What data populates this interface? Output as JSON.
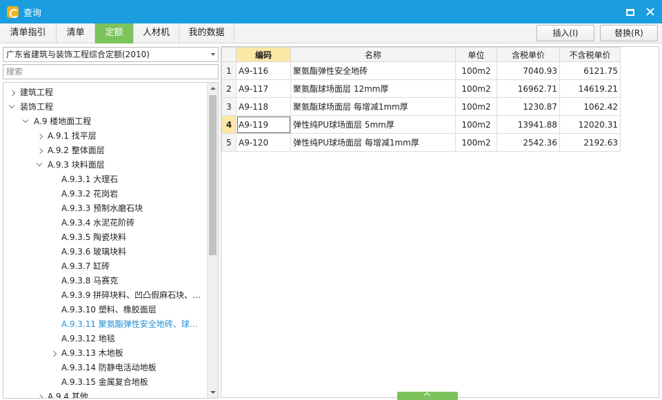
{
  "window": {
    "title": "查询"
  },
  "tabs": [
    {
      "label": "清单指引"
    },
    {
      "label": "清单"
    },
    {
      "label": "定额"
    },
    {
      "label": "人材机"
    },
    {
      "label": "我的数据"
    }
  ],
  "actions": {
    "insert_label": "插入(I)",
    "replace_label": "替换(R)"
  },
  "left": {
    "library": "广东省建筑与装饰工程综合定额(2010)",
    "search_placeholder": "搜索",
    "tree": [
      {
        "label": "建筑工程",
        "level": 0,
        "state": "collapsed"
      },
      {
        "label": "装饰工程",
        "level": 0,
        "state": "expanded"
      },
      {
        "label": "A.9  楼地面工程",
        "level": 1,
        "state": "expanded"
      },
      {
        "label": "A.9.1  找平层",
        "level": 2,
        "state": "collapsed"
      },
      {
        "label": "A.9.2  整体面层",
        "level": 2,
        "state": "collapsed"
      },
      {
        "label": "A.9.3  块料面层",
        "level": 2,
        "state": "expanded"
      },
      {
        "label": "A.9.3.1  大理石",
        "level": 3,
        "state": "leaf"
      },
      {
        "label": "A.9.3.2  花岗岩",
        "level": 3,
        "state": "leaf"
      },
      {
        "label": "A.9.3.3  预制水磨石块",
        "level": 3,
        "state": "leaf"
      },
      {
        "label": "A.9.3.4  水泥花阶砖",
        "level": 3,
        "state": "leaf"
      },
      {
        "label": "A.9.3.5  陶瓷块料",
        "level": 3,
        "state": "leaf"
      },
      {
        "label": "A.9.3.6  玻璃块料",
        "level": 3,
        "state": "leaf"
      },
      {
        "label": "A.9.3.7  缸砖",
        "level": 3,
        "state": "leaf"
      },
      {
        "label": "A.9.3.8  马赛克",
        "level": 3,
        "state": "leaf"
      },
      {
        "label": "A.9.3.9  拼碎块料、凹凸假麻石块、…",
        "level": 3,
        "state": "leaf"
      },
      {
        "label": "A.9.3.10  塑料、橡胶面层",
        "level": 3,
        "state": "leaf"
      },
      {
        "label": "A.9.3.11  聚氨酯弹性安全地砖、球…",
        "level": 3,
        "state": "leaf",
        "selected": true
      },
      {
        "label": "A.9.3.12  地毯",
        "level": 3,
        "state": "leaf"
      },
      {
        "label": "A.9.3.13  木地板",
        "level": 3,
        "state": "collapsed"
      },
      {
        "label": "A.9.3.14  防静电活动地板",
        "level": 3,
        "state": "leaf"
      },
      {
        "label": "A.9.3.15  金属复合地板",
        "level": 3,
        "state": "leaf"
      },
      {
        "label": "A.9.4  其他",
        "level": 2,
        "state": "collapsed"
      }
    ]
  },
  "grid": {
    "headers": [
      "编码",
      "名称",
      "单位",
      "含税单价",
      "不含税单价"
    ],
    "rows": [
      {
        "n": "1",
        "code": "A9-116",
        "name": "聚氨酯弹性安全地砖",
        "unit": "100m2",
        "tax": "7040.93",
        "notax": "6121.75"
      },
      {
        "n": "2",
        "code": "A9-117",
        "name": "聚氨酯球场面层 12mm厚",
        "unit": "100m2",
        "tax": "16962.71",
        "notax": "14619.21"
      },
      {
        "n": "3",
        "code": "A9-118",
        "name": "聚氨酯球场面层 每增减1mm厚",
        "unit": "100m2",
        "tax": "1230.87",
        "notax": "1062.42"
      },
      {
        "n": "4",
        "code": "A9-119",
        "name": "弹性纯PU球场面层 5mm厚",
        "unit": "100m2",
        "tax": "13941.88",
        "notax": "12020.31"
      },
      {
        "n": "5",
        "code": "A9-120",
        "name": "弹性纯PU球场面层 每增减1mm厚",
        "unit": "100m2",
        "tax": "2542.36",
        "notax": "2192.63"
      }
    ],
    "current_row": 3
  }
}
